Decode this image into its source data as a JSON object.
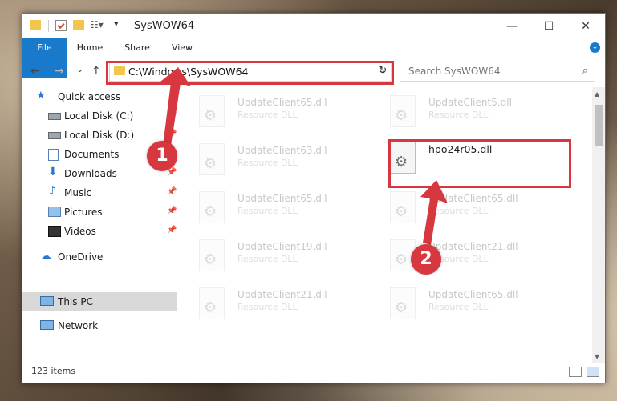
{
  "window": {
    "title": "SysWOW64"
  },
  "controls": {
    "minimize": "—",
    "maximize": "☐",
    "close": "✕"
  },
  "ribbon": {
    "tabs": [
      "File",
      "Home",
      "Share",
      "View"
    ]
  },
  "nav": {
    "back": "←",
    "forward": "→",
    "recent": "⌄",
    "up": "↑",
    "address": "C:\\Windows\\SysWOW64",
    "search_placeholder": "Search SysWOW64"
  },
  "sidebar": {
    "items": [
      {
        "label": "Quick access",
        "icon": "star-icon"
      },
      {
        "label": "Local Disk (C:)",
        "icon": "drive-icon"
      },
      {
        "label": "Local Disk (D:)",
        "icon": "drive-icon"
      },
      {
        "label": "Documents",
        "icon": "documents-icon"
      },
      {
        "label": "Downloads",
        "icon": "downloads-icon"
      },
      {
        "label": "Music",
        "icon": "music-icon"
      },
      {
        "label": "Pictures",
        "icon": "pictures-icon"
      },
      {
        "label": "Videos",
        "icon": "videos-icon"
      },
      {
        "label": "OneDrive",
        "icon": "cloud-icon"
      },
      {
        "label": "This PC",
        "icon": "pc-icon"
      },
      {
        "label": "Network",
        "icon": "network-icon"
      }
    ]
  },
  "files": [
    {
      "name": "UpdateClient65.dll",
      "type": "Resource DLL"
    },
    {
      "name": "UpdateClient5.dll",
      "type": "Resource DLL"
    },
    {
      "name": "UpdateClient63.dll",
      "type": "Resource DLL"
    },
    {
      "name": "hpo24r05.dll",
      "type": ""
    },
    {
      "name": "UpdateClient65.dll",
      "type": "Resource DLL"
    },
    {
      "name": "UpdateClient65.dll",
      "type": "Resource DLL"
    },
    {
      "name": "UpdateClient19.dll",
      "type": "Resource DLL"
    },
    {
      "name": "UpdateClient21.dll",
      "type": "Resource DLL"
    },
    {
      "name": "UpdateClient21.dll",
      "type": "Resource DLL"
    },
    {
      "name": "UpdateClient65.dll",
      "type": "Resource DLL"
    }
  ],
  "status": {
    "count": "123 items"
  },
  "markers": [
    "1",
    "2"
  ],
  "colors": {
    "accent": "#1979ca",
    "highlight": "#d7373f"
  }
}
